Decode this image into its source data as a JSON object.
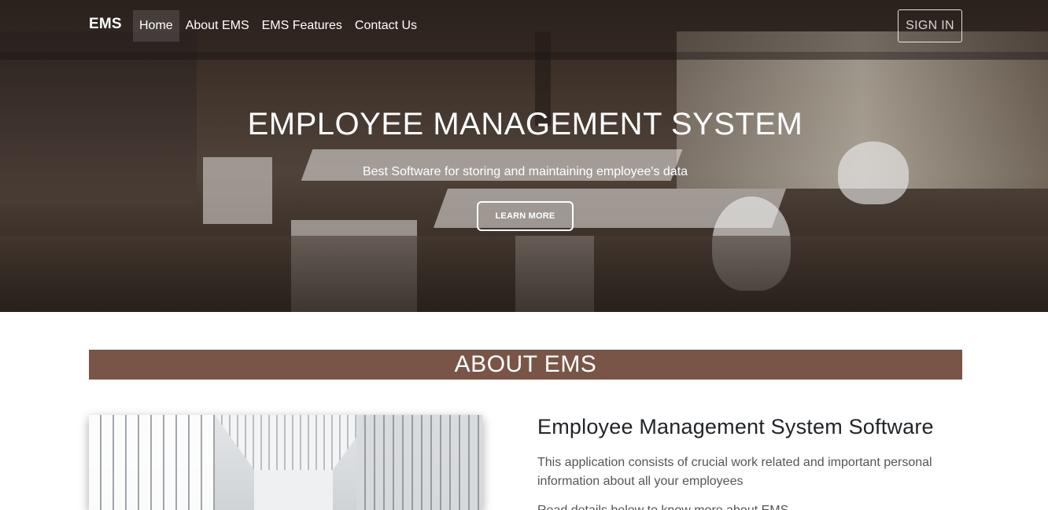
{
  "navbar": {
    "brand": "EMS",
    "links": [
      "Home",
      "About EMS",
      "EMS Features",
      "Contact Us"
    ],
    "active_index": 0,
    "sign_in_label": "SIGN IN"
  },
  "hero": {
    "title": "EMPLOYEE MANAGEMENT SYSTEM",
    "subtitle": "Best Software for storing and maintaining employee's data",
    "button_label": "LEARN MORE"
  },
  "about": {
    "section_title": "ABOUT EMS",
    "heading": "Employee Management System Software",
    "paragraph": "This application consists of crucial work related and important personal information about all your employees",
    "paragraph2": "Read details below to know more about EMS"
  },
  "colors": {
    "accent": "#795548",
    "hero_text": "#ffffff"
  }
}
